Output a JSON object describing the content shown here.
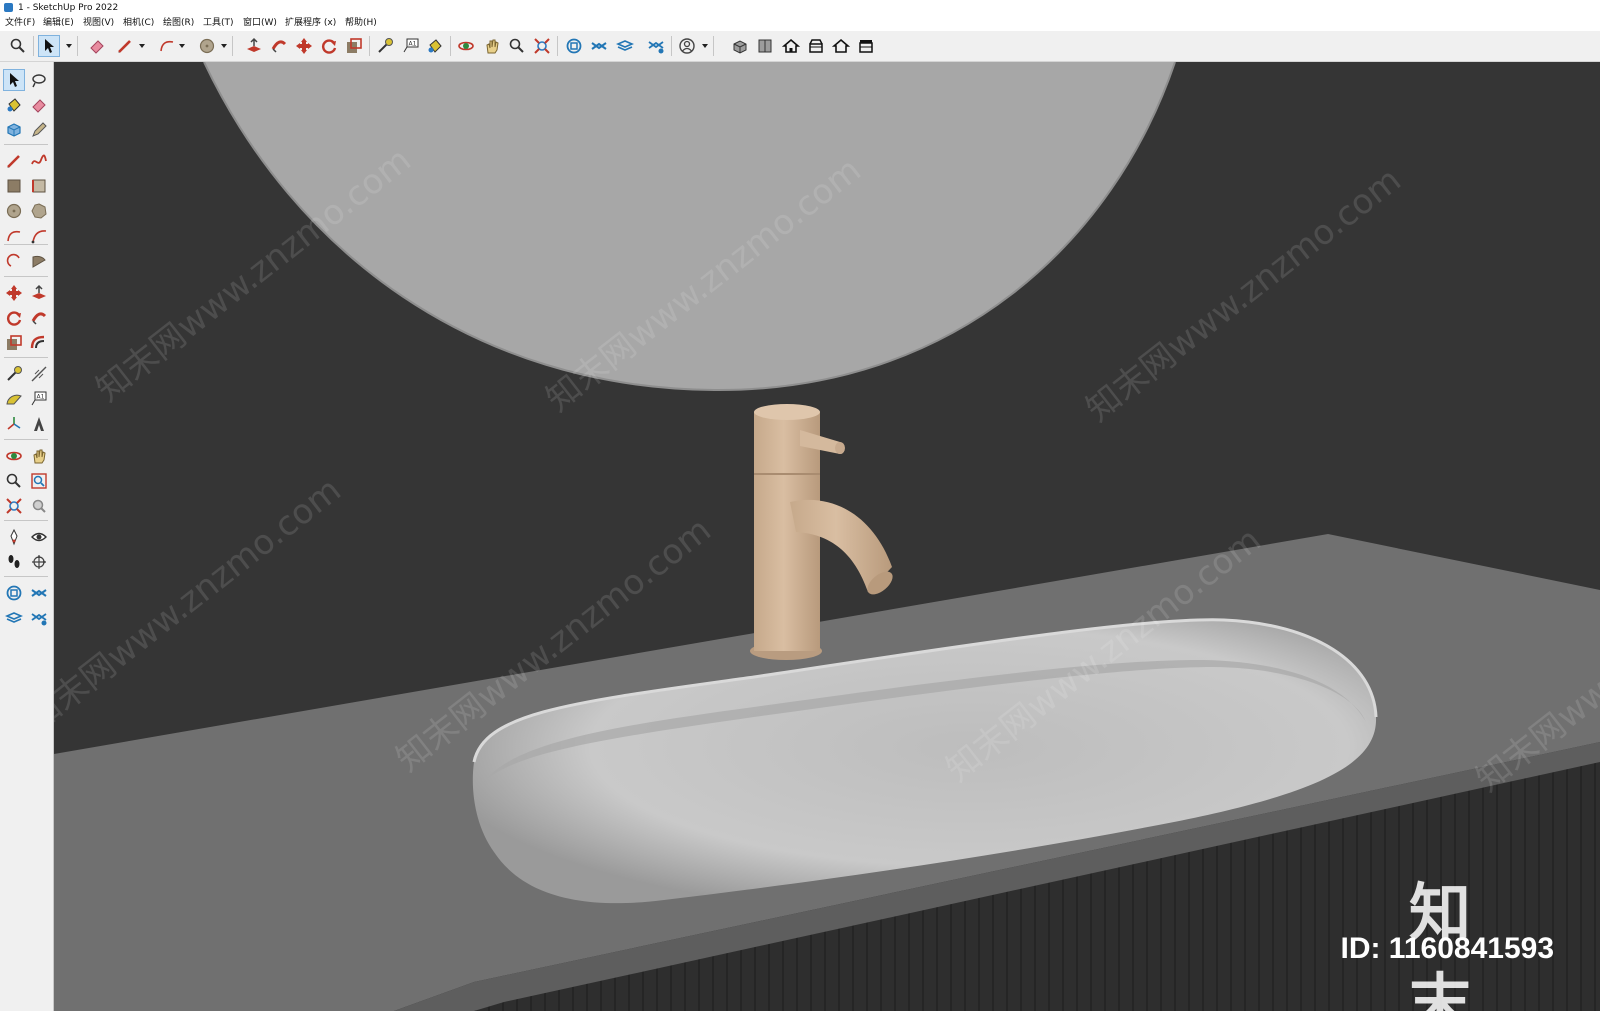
{
  "window": {
    "title": "1 - SketchUp Pro 2022",
    "icon": "sketchup-app-icon"
  },
  "menu": [
    {
      "label": "文件(F)"
    },
    {
      "label": "编辑(E)"
    },
    {
      "label": "视图(V)"
    },
    {
      "label": "相机(C)"
    },
    {
      "label": "绘图(R)"
    },
    {
      "label": "工具(T)"
    },
    {
      "label": "窗口(W)"
    },
    {
      "label": "扩展程序 (x)"
    },
    {
      "label": "帮助(H)"
    }
  ],
  "toolbar": {
    "tools": [
      {
        "icon": "zoom-icon"
      },
      {
        "icon": "select-arrow-icon",
        "active": true
      },
      {
        "icon": "dropdown-arrow-icon"
      },
      {
        "icon": "eraser-icon"
      },
      {
        "icon": "pencil-line-icon"
      },
      {
        "icon": "dropdown-arrow-icon"
      },
      {
        "icon": "arc-icon"
      },
      {
        "icon": "dropdown-arrow-icon"
      },
      {
        "icon": "circle-icon"
      },
      {
        "icon": "dropdown-arrow-icon"
      },
      {
        "icon": "push-pull-icon"
      },
      {
        "icon": "follow-me-icon"
      },
      {
        "icon": "move-icon"
      },
      {
        "icon": "rotate-icon"
      },
      {
        "icon": "scale-icon"
      },
      {
        "icon": "tape-measure-icon"
      },
      {
        "icon": "text-label-icon"
      },
      {
        "icon": "paint-bucket-icon"
      },
      {
        "icon": "orbit-icon"
      },
      {
        "icon": "pan-icon"
      },
      {
        "icon": "zoom-icon"
      },
      {
        "icon": "zoom-extents-icon"
      },
      {
        "icon": "warehouse-icon"
      },
      {
        "icon": "extension-warehouse-icon"
      },
      {
        "icon": "layout-icon"
      },
      {
        "icon": "extension-manager-icon"
      },
      {
        "icon": "account-icon"
      },
      {
        "icon": "dropdown-arrow-icon"
      },
      {
        "icon": "iso-view-icon"
      },
      {
        "icon": "top-view-icon"
      },
      {
        "icon": "front-view-icon"
      },
      {
        "icon": "right-view-icon"
      },
      {
        "icon": "back-view-icon"
      },
      {
        "icon": "left-view-icon"
      }
    ]
  },
  "sidebar": {
    "tools": [
      {
        "icon": "select-arrow-icon",
        "active": true
      },
      {
        "icon": "orbit-lasso-icon"
      },
      {
        "icon": "paint-bucket-icon"
      },
      {
        "icon": "eraser-icon"
      },
      {
        "icon": "component-icon"
      },
      {
        "icon": "tag-pencil-icon"
      },
      {
        "icon": "pencil-line-icon"
      },
      {
        "icon": "freehand-icon"
      },
      {
        "icon": "rectangle-icon"
      },
      {
        "icon": "rotated-rectangle-icon"
      },
      {
        "icon": "circle-icon"
      },
      {
        "icon": "polygon-icon"
      },
      {
        "icon": "arc-icon"
      },
      {
        "icon": "two-point-arc-icon"
      },
      {
        "icon": "three-point-arc-icon"
      },
      {
        "icon": "pie-icon"
      },
      {
        "icon": "move-icon"
      },
      {
        "icon": "push-pull-icon"
      },
      {
        "icon": "rotate-icon"
      },
      {
        "icon": "follow-me-icon"
      },
      {
        "icon": "scale-icon"
      },
      {
        "icon": "offset-icon"
      },
      {
        "icon": "tape-measure-icon"
      },
      {
        "icon": "dimension-icon"
      },
      {
        "icon": "protractor-icon"
      },
      {
        "icon": "text-label-icon"
      },
      {
        "icon": "axes-icon"
      },
      {
        "icon": "3d-text-icon"
      },
      {
        "icon": "orbit-icon"
      },
      {
        "icon": "pan-icon"
      },
      {
        "icon": "zoom-icon"
      },
      {
        "icon": "zoom-window-icon"
      },
      {
        "icon": "zoom-extents-icon"
      },
      {
        "icon": "previous-view-icon"
      },
      {
        "icon": "position-camera-icon"
      },
      {
        "icon": "look-around-icon"
      },
      {
        "icon": "walk-icon"
      },
      {
        "icon": "section-plane-icon"
      },
      {
        "icon": "warehouse-icon"
      },
      {
        "icon": "extension-warehouse-icon"
      },
      {
        "icon": "layout-icon"
      },
      {
        "icon": "extension-manager-icon"
      }
    ]
  },
  "viewport": {
    "scene": "bathroom-vanity-model",
    "colors": {
      "background": "#353535",
      "mirror": "#a7a7a7",
      "countertop": "#6f6f6f",
      "basin": "#c4c4c4",
      "faucet": "#d2b79b",
      "cabinet": "#2e2e2e"
    },
    "watermark_text": "知末网www.znzmo.com",
    "watermark_logo": "知末",
    "watermark_id": "ID: 1160841593"
  }
}
